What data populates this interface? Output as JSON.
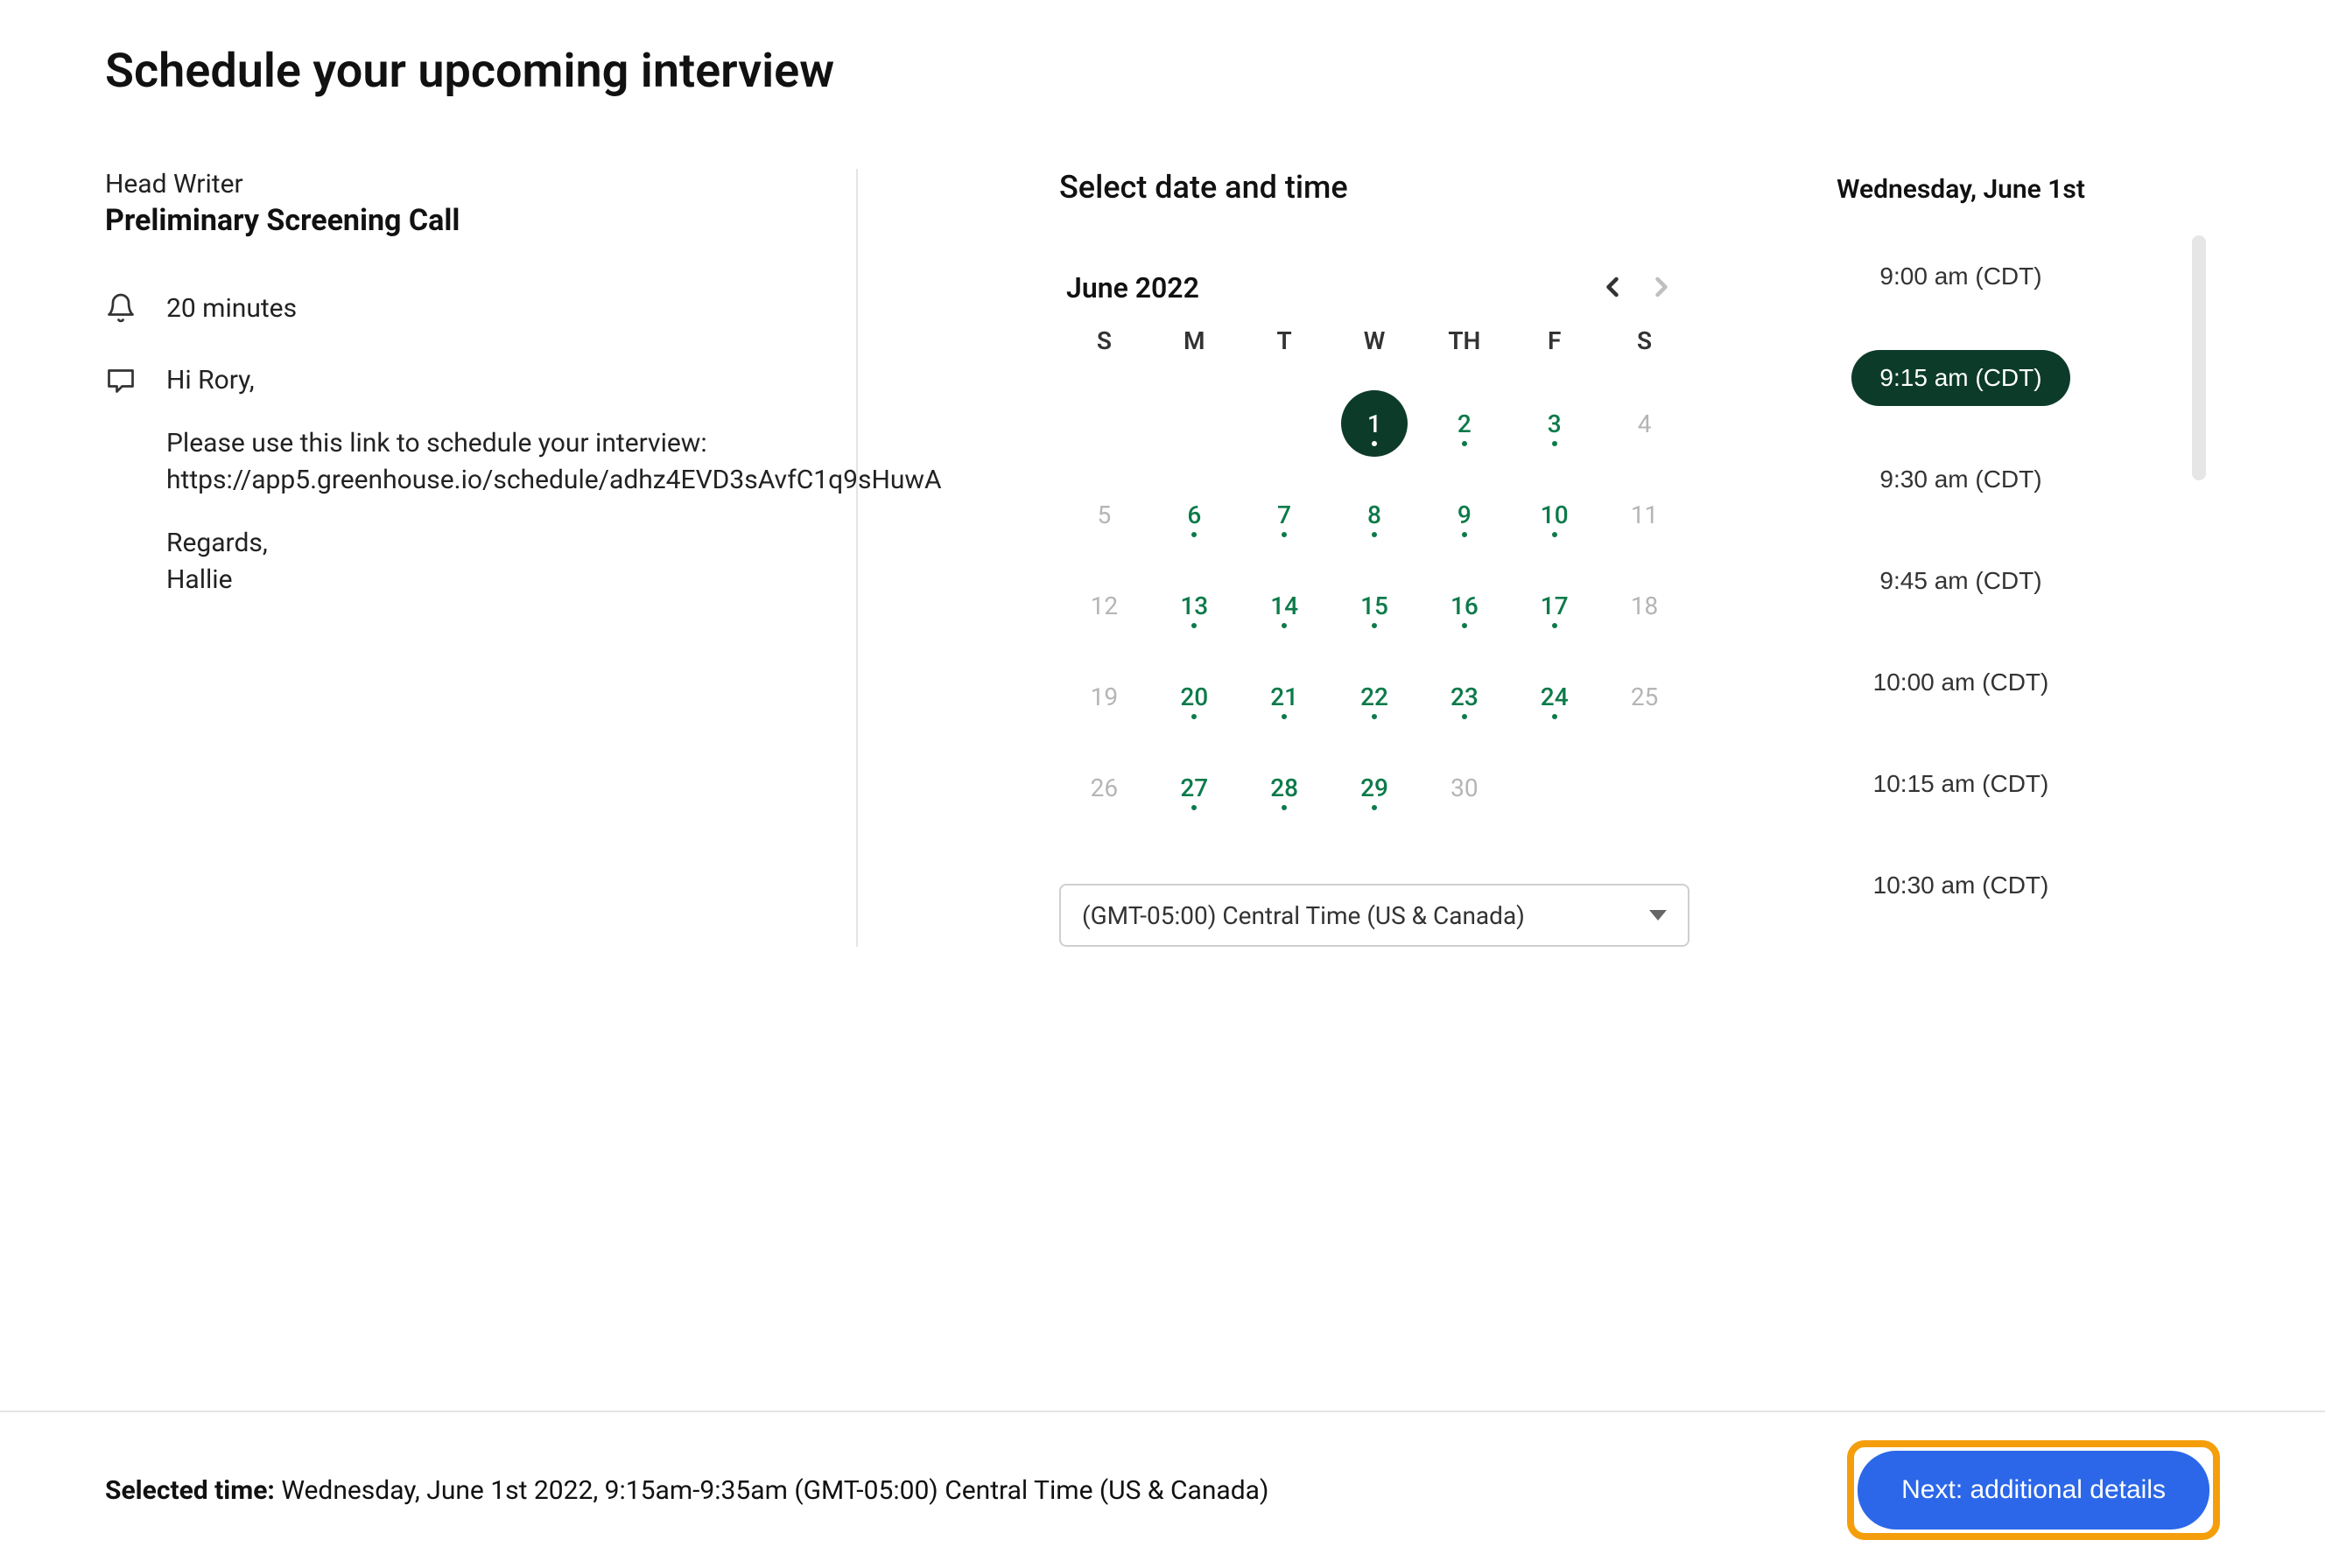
{
  "page_title": "Schedule your upcoming interview",
  "left": {
    "job_title": "Head Writer",
    "event_title": "Preliminary Screening Call",
    "duration": "20 minutes",
    "message_greeting": "Hi Rory,",
    "message_body": "Please use this link to schedule your interview: https://app5.greenhouse.io/schedule/adhz4EVD3sAvfC1q9sHuwA",
    "message_signoff": "Regards,\nHallie"
  },
  "section_heading": "Select date and time",
  "calendar": {
    "month_label": "June 2022",
    "dow": [
      "S",
      "M",
      "T",
      "W",
      "TH",
      "F",
      "S"
    ],
    "weeks": [
      [
        {
          "n": "",
          "state": "blank"
        },
        {
          "n": "",
          "state": "blank"
        },
        {
          "n": "",
          "state": "blank"
        },
        {
          "n": "1",
          "state": "selected"
        },
        {
          "n": "2",
          "state": "available"
        },
        {
          "n": "3",
          "state": "available"
        },
        {
          "n": "4",
          "state": "inactive"
        }
      ],
      [
        {
          "n": "5",
          "state": "inactive"
        },
        {
          "n": "6",
          "state": "available"
        },
        {
          "n": "7",
          "state": "available"
        },
        {
          "n": "8",
          "state": "available"
        },
        {
          "n": "9",
          "state": "available"
        },
        {
          "n": "10",
          "state": "available"
        },
        {
          "n": "11",
          "state": "inactive"
        }
      ],
      [
        {
          "n": "12",
          "state": "inactive"
        },
        {
          "n": "13",
          "state": "available"
        },
        {
          "n": "14",
          "state": "available"
        },
        {
          "n": "15",
          "state": "available"
        },
        {
          "n": "16",
          "state": "available"
        },
        {
          "n": "17",
          "state": "available"
        },
        {
          "n": "18",
          "state": "inactive"
        }
      ],
      [
        {
          "n": "19",
          "state": "inactive"
        },
        {
          "n": "20",
          "state": "available"
        },
        {
          "n": "21",
          "state": "available"
        },
        {
          "n": "22",
          "state": "available"
        },
        {
          "n": "23",
          "state": "available"
        },
        {
          "n": "24",
          "state": "available"
        },
        {
          "n": "25",
          "state": "inactive"
        }
      ],
      [
        {
          "n": "26",
          "state": "inactive"
        },
        {
          "n": "27",
          "state": "available"
        },
        {
          "n": "28",
          "state": "available"
        },
        {
          "n": "29",
          "state": "available"
        },
        {
          "n": "30",
          "state": "inactive"
        },
        {
          "n": "",
          "state": "blank"
        },
        {
          "n": "",
          "state": "blank"
        }
      ]
    ]
  },
  "timezone": {
    "selected": "(GMT-05:00) Central Time (US & Canada)"
  },
  "times": {
    "selected_date": "Wednesday, June 1st",
    "slots": [
      {
        "label": "9:00 am (CDT)",
        "selected": false
      },
      {
        "label": "9:15 am (CDT)",
        "selected": true
      },
      {
        "label": "9:30 am (CDT)",
        "selected": false
      },
      {
        "label": "9:45 am (CDT)",
        "selected": false
      },
      {
        "label": "10:00 am (CDT)",
        "selected": false
      },
      {
        "label": "10:15 am (CDT)",
        "selected": false
      },
      {
        "label": "10:30 am (CDT)",
        "selected": false
      }
    ]
  },
  "footer": {
    "selected_label": "Selected time:",
    "selected_value": "Wednesday, June 1st 2022, 9:15am-9:35am (GMT-05:00) Central Time (US & Canada)",
    "next_button": "Next: additional details"
  }
}
